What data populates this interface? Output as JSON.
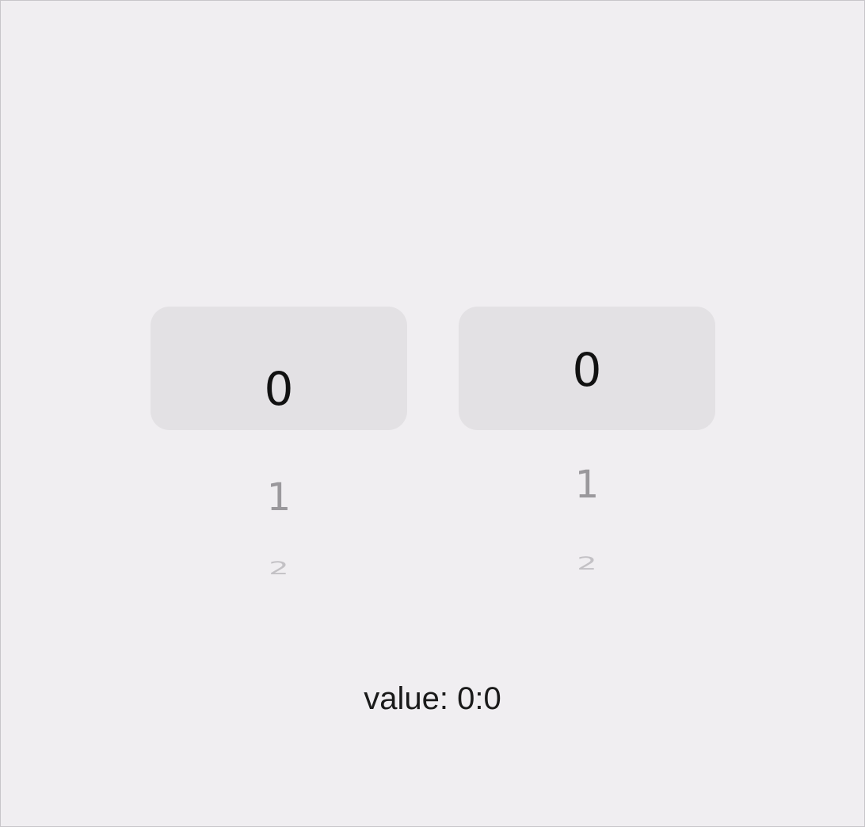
{
  "pickers": [
    {
      "selected": "0",
      "below_1": "1",
      "below_2": "2"
    },
    {
      "selected": "0",
      "below_1": "1",
      "below_2": "2"
    }
  ],
  "value_label": "value: 0:0",
  "colors": {
    "background": "#f0eef1",
    "highlight": "#e3e1e4",
    "selected_text": "#111111",
    "near_text": "#9a989c",
    "far_text": "#c3c1c5"
  }
}
